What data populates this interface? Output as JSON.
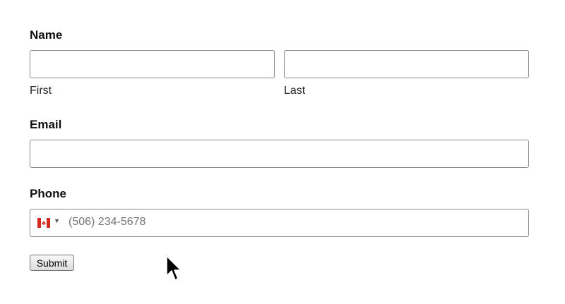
{
  "form": {
    "name_label": "Name",
    "first_sublabel": "First",
    "last_sublabel": "Last",
    "first_value": "",
    "last_value": "",
    "email_label": "Email",
    "email_value": "",
    "phone_label": "Phone",
    "phone_country_icon": "canada-flag-icon",
    "phone_placeholder": "(506) 234-5678",
    "submit_label": "Submit"
  },
  "colors": {
    "border": "#8a8a8a",
    "flag_red": "#d52b1e",
    "placeholder": "#757575"
  }
}
